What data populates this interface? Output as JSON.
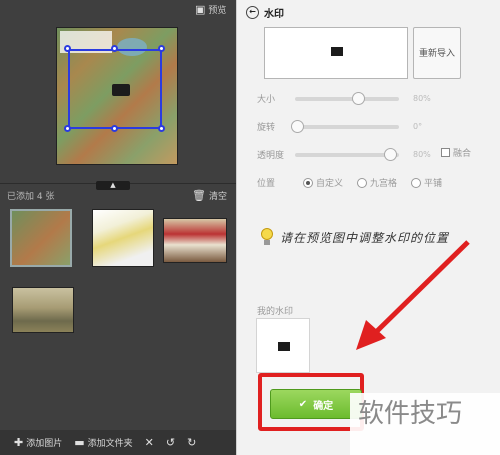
{
  "left_panel": {
    "preview_label": "预览",
    "collapse_symbol": "▲",
    "added_count": "已添加 4 张",
    "clear_label": "清空",
    "bottom_buttons": {
      "add_image": "添加图片",
      "add_folder": "添加文件夹"
    }
  },
  "right_panel": {
    "title": "水印",
    "reimport_label": "重新导入",
    "sliders": [
      {
        "label": "大小",
        "value": "80%"
      },
      {
        "label": "旋转",
        "value": "0°"
      },
      {
        "label": "透明度",
        "value": "80%"
      }
    ],
    "blend_label": "融合",
    "position": {
      "label": "位置",
      "options": [
        "自定义",
        "九宫格",
        "平铺"
      ],
      "selected": "自定义"
    },
    "hint": "请在预览图中调整水印的位置",
    "my_watermark_label": "我的水印",
    "confirm_label": "确定"
  },
  "overlay": {
    "site_watermark": "软件技巧",
    "arrow_color": "#e02020"
  },
  "colors": {
    "selection": "#2b3be0",
    "confirm_green": "#6cbc2e",
    "highlight_red": "#e02020"
  }
}
